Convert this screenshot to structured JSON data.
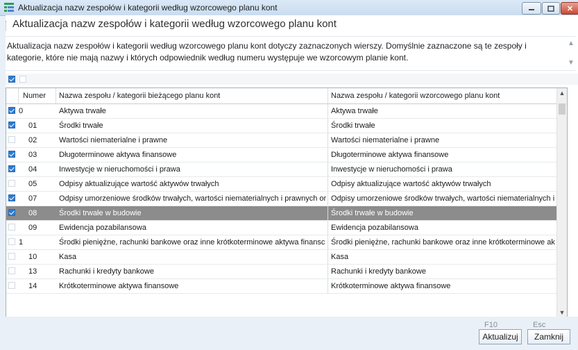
{
  "window": {
    "title": "Aktualizacja nazw zespołów i kategorii według wzorcowego planu kont",
    "close_symbol": "✕"
  },
  "header": {
    "title": "Aktualizacja nazw zespołów i kategorii według wzorcowego planu kont"
  },
  "description": {
    "text": "Aktualizacja nazw zespołów i kategorii według wzorcowego planu kont dotyczy zaznaczonych wierszy. Domyślnie zaznaczone są te zespoły i kategorie, które nie mają nazwy i których odpowiednik według numeru występuje we wzorcowym planie kont."
  },
  "grid": {
    "columns": {
      "number": "Numer",
      "current": "Nazwa zespołu / kategorii bieżącego planu kont",
      "template": "Nazwa zespołu / kategorii wzorcowego planu kont"
    },
    "rows": [
      {
        "checked": true,
        "number": "0",
        "current": "Aktywa trwałe",
        "template": "Aktywa trwałe",
        "selected": false,
        "top": true
      },
      {
        "checked": true,
        "number": "01",
        "current": "Środki trwałe",
        "template": "Środki trwałe",
        "selected": false,
        "top": false
      },
      {
        "checked": false,
        "number": "02",
        "current": "Wartości niematerialne i prawne",
        "template": "Wartości niematerialne i prawne",
        "selected": false,
        "top": false
      },
      {
        "checked": true,
        "number": "03",
        "current": "Długoterminowe aktywa finansowe",
        "template": "Długoterminowe aktywa finansowe",
        "selected": false,
        "top": false
      },
      {
        "checked": true,
        "number": "04",
        "current": "Inwestycje w nieruchomości i prawa",
        "template": "Inwestycje w nieruchomości i prawa",
        "selected": false,
        "top": false
      },
      {
        "checked": false,
        "number": "05",
        "current": "Odpisy aktualizujące wartość aktywów trwałych",
        "template": "Odpisy aktualizujące wartość aktywów trwałych",
        "selected": false,
        "top": false
      },
      {
        "checked": true,
        "number": "07",
        "current": "Odpisy umorzeniowe środków trwałych, wartości niematerialnych i prawnych or",
        "template": "Odpisy umorzeniowe środków trwałych, wartości niematerialnych i p",
        "selected": false,
        "top": false
      },
      {
        "checked": true,
        "number": "08",
        "current": "Środki trwałe w budowie",
        "template": "Środki trwałe w budowie",
        "selected": true,
        "top": false
      },
      {
        "checked": false,
        "number": "09",
        "current": "Ewidencja pozabilansowa",
        "template": "Ewidencja pozabilansowa",
        "selected": false,
        "top": false
      },
      {
        "checked": false,
        "number": "1",
        "current": "Środki pieniężne, rachunki bankowe oraz inne krótkoterminowe aktywa finansc",
        "template": "Środki pieniężne, rachunki bankowe oraz inne krótkoterminowe ak",
        "selected": false,
        "top": true
      },
      {
        "checked": false,
        "number": "10",
        "current": "Kasa",
        "template": "Kasa",
        "selected": false,
        "top": false
      },
      {
        "checked": false,
        "number": "13",
        "current": "Rachunki i kredyty bankowe",
        "template": "Rachunki i kredyty bankowe",
        "selected": false,
        "top": false
      },
      {
        "checked": false,
        "number": "14",
        "current": "Krótkoterminowe aktywa finansowe",
        "template": "Krótkoterminowe aktywa finansowe",
        "selected": false,
        "top": false
      }
    ]
  },
  "footer": {
    "update_key": "F10",
    "update_label": "Aktualizuj",
    "close_key": "Esc",
    "close_label": "Zamknij"
  },
  "icons": {
    "scroll_up": "▲",
    "scroll_down": "▼",
    "desc_up": "▲",
    "desc_down": "▼"
  },
  "colors": {
    "accent": "#2e7ad1",
    "selected_row": "#8c8c8c",
    "close_button": "#c94a33"
  }
}
